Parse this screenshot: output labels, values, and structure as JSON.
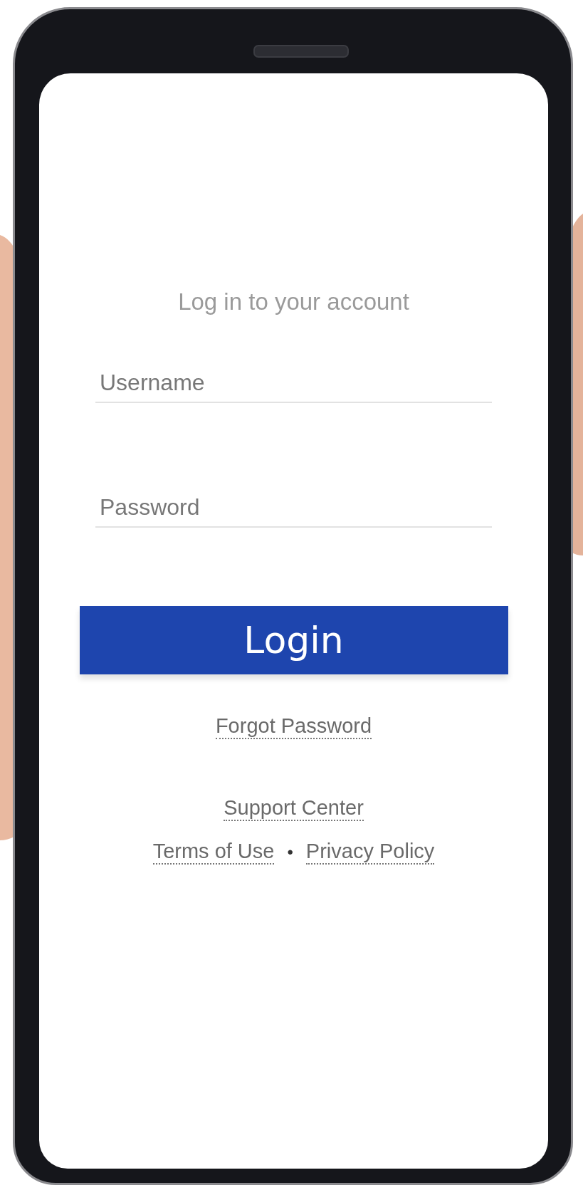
{
  "heading": "Log in to your account",
  "fields": [
    {
      "placeholder": "Username"
    },
    {
      "placeholder": "Password"
    }
  ],
  "login_button": "Login",
  "links": {
    "forgot": "Forgot Password",
    "support": "Support Center",
    "terms": "Terms of Use",
    "separator": "•",
    "privacy": "Privacy Policy"
  }
}
